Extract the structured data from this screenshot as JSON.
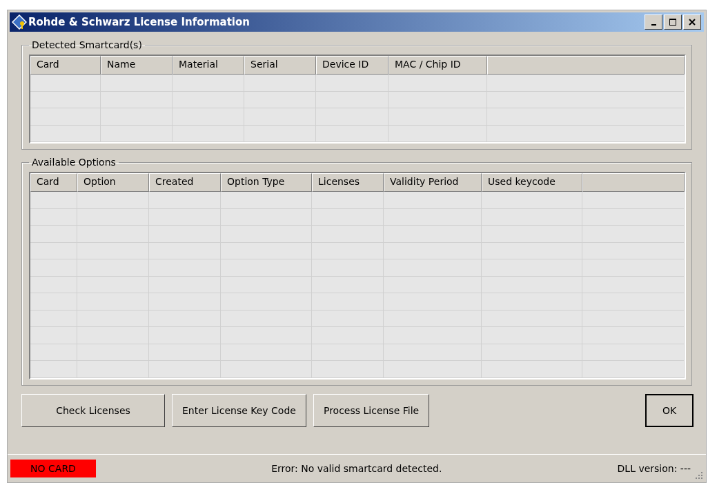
{
  "window": {
    "title": "Rohde & Schwarz License Information"
  },
  "smartcards": {
    "title": "Detected Smartcard(s)",
    "columns": [
      "Card",
      "Name",
      "Material",
      "Serial",
      "Device ID",
      "MAC / Chip ID"
    ]
  },
  "options": {
    "title": "Available Options",
    "columns": [
      "Card",
      "Option",
      "Created",
      "Option Type",
      "Licenses",
      "Validity Period",
      "Used keycode"
    ]
  },
  "buttons": [
    {
      "label": "Check Licenses",
      "kind": "action"
    },
    {
      "label": "Enter License Key Code",
      "kind": "action"
    },
    {
      "label": "Process License File",
      "kind": "action"
    },
    {
      "label": "OK",
      "kind": "default"
    }
  ],
  "status_bar": {
    "card_status": "NO CARD",
    "color": "#ff0000",
    "message": "Error: No valid smartcard detected.",
    "dll_version": "DLL version: ---"
  }
}
